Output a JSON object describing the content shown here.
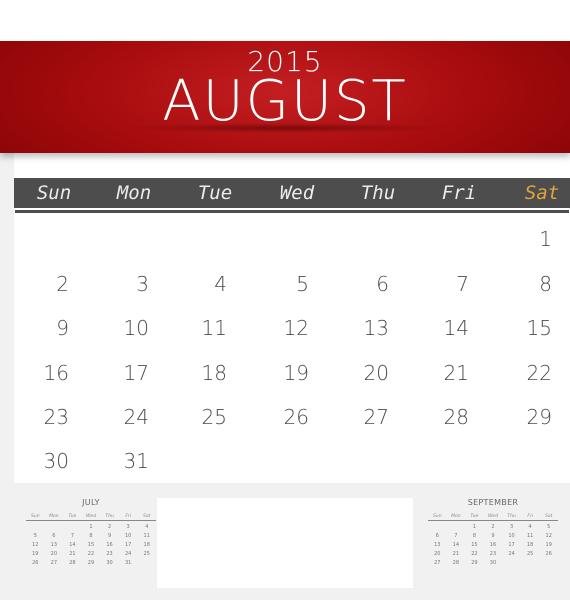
{
  "header": {
    "year": "2015",
    "month": "AUGUST"
  },
  "weekdays": [
    "Sun",
    "Mon",
    "Tue",
    "Wed",
    "Thu",
    "Fri",
    "Sat"
  ],
  "colors": {
    "banner_red": "#a80c0e",
    "weekbar_gray": "#4d4d4d",
    "saturday_accent": "#e2a53d",
    "day_text": "#4a4a4a"
  },
  "calendar": {
    "first_weekday_index": 6,
    "weeks": [
      [
        "",
        "",
        "",
        "",
        "",
        "",
        "1"
      ],
      [
        "2",
        "3",
        "4",
        "5",
        "6",
        "7",
        "8"
      ],
      [
        "9",
        "10",
        "11",
        "12",
        "13",
        "14",
        "15"
      ],
      [
        "16",
        "17",
        "18",
        "19",
        "20",
        "21",
        "22"
      ],
      [
        "23",
        "24",
        "25",
        "26",
        "27",
        "28",
        "29"
      ],
      [
        "30",
        "31",
        "",
        "",
        "",
        "",
        ""
      ]
    ]
  },
  "mini_prev": {
    "title": "JULY",
    "weekdays": [
      "Sun",
      "Mon",
      "Tue",
      "Wed",
      "Thu",
      "Fri",
      "Sat"
    ],
    "days": [
      "",
      "",
      "",
      "1",
      "2",
      "3",
      "4",
      "5",
      "6",
      "7",
      "8",
      "9",
      "10",
      "11",
      "12",
      "13",
      "14",
      "15",
      "16",
      "17",
      "18",
      "19",
      "20",
      "21",
      "22",
      "23",
      "24",
      "25",
      "26",
      "27",
      "28",
      "29",
      "30",
      "31",
      ""
    ]
  },
  "mini_next": {
    "title": "SEPTEMBER",
    "weekdays": [
      "Sun",
      "Mon",
      "Tue",
      "Wed",
      "Thu",
      "Fri",
      "Sat"
    ],
    "days": [
      "",
      "",
      "1",
      "2",
      "3",
      "4",
      "5",
      "6",
      "7",
      "8",
      "9",
      "10",
      "11",
      "12",
      "13",
      "14",
      "15",
      "16",
      "17",
      "18",
      "19",
      "20",
      "21",
      "22",
      "23",
      "24",
      "25",
      "26",
      "27",
      "28",
      "29",
      "30",
      "",
      "",
      ""
    ]
  }
}
